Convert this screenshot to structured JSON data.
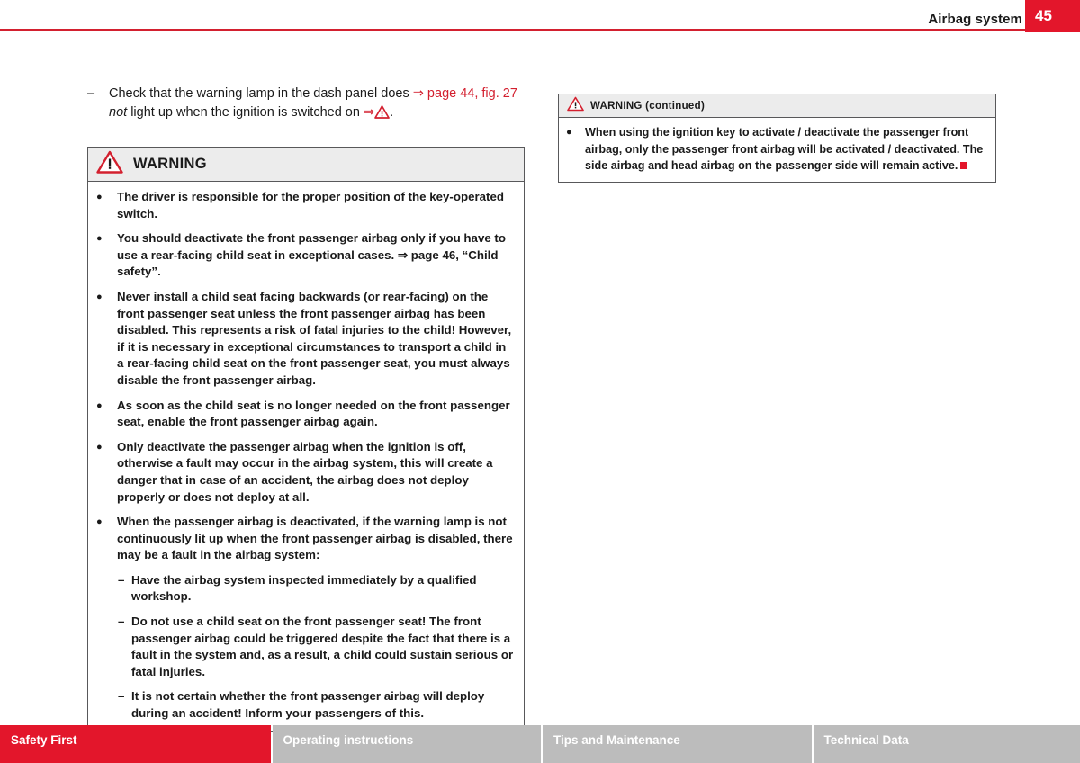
{
  "header": {
    "title": "Airbag system",
    "page_number": "45",
    "accent_color": "#e3162b",
    "rule_color": "#d3202f"
  },
  "intro": {
    "dash": "–",
    "part1": "Check that the warning lamp in the dash panel does ",
    "arrow1": "⇒",
    "xref1": " page 44, fig. 27",
    "italic": " not",
    "part2": " light up when the ignition is switched on ",
    "arrow2": "⇒",
    "period": "."
  },
  "warning_main": {
    "icon": "warning-triangle-icon",
    "title": "WARNING",
    "bullet": "●",
    "dash": "–",
    "items": [
      {
        "type": "bullet",
        "text": "The driver is responsible for the proper position of the key-operated switch."
      },
      {
        "type": "bullet",
        "text": "You should deactivate the front passenger airbag only if you have to use a rear-facing child seat in exceptional cases. ⇒ page 46, “Child safety”."
      },
      {
        "type": "bullet",
        "text": "Never install a child seat facing backwards (or rear-facing) on the front passenger seat unless the front passenger airbag has been disabled. This represents a risk of fatal injuries to the child! However, if it is necessary in exceptional circumstances to transport a child in a rear-facing child seat on the front passenger seat, you must always disable the front passenger airbag."
      },
      {
        "type": "bullet",
        "text": "As soon as the child seat is no longer needed on the front passenger seat, enable the front passenger airbag again."
      },
      {
        "type": "bullet",
        "text": "Only deactivate the passenger airbag when the ignition is off, otherwise a fault may occur in the airbag system, this will create a danger that in case of an accident, the airbag does not deploy properly or does not deploy at all."
      },
      {
        "type": "bullet",
        "text": "When the passenger airbag is deactivated, if the warning lamp is not continuously lit up when the front passenger airbag is disabled, there may be a fault in the airbag system:"
      },
      {
        "type": "sub",
        "text": "Have the airbag system inspected immediately by a qualified workshop."
      },
      {
        "type": "sub",
        "text": "Do not use a child seat on the front passenger seat! The front passenger airbag could be triggered despite the fact that there is a fault in the system and, as a result, a child could sustain serious or fatal injuries."
      },
      {
        "type": "sub",
        "text": "It is not certain whether the front passenger airbag will deploy during an accident! Inform your passengers of this."
      }
    ]
  },
  "warning_continued": {
    "icon": "warning-triangle-icon",
    "title": "WARNING (continued)",
    "bullet": "●",
    "items": [
      {
        "type": "bullet",
        "text": "When using the ignition key to activate / deactivate the passenger front airbag, only the passenger front airbag will be activated / deactivated. The side airbag and head airbag on the passenger side will remain active."
      }
    ],
    "end_marker": "red-square-end-marker"
  },
  "footer": {
    "tabs": [
      {
        "label": "Safety First",
        "active": true
      },
      {
        "label": "Operating instructions",
        "active": false
      },
      {
        "label": "Tips and Maintenance",
        "active": false
      },
      {
        "label": "Technical Data",
        "active": false
      }
    ]
  }
}
